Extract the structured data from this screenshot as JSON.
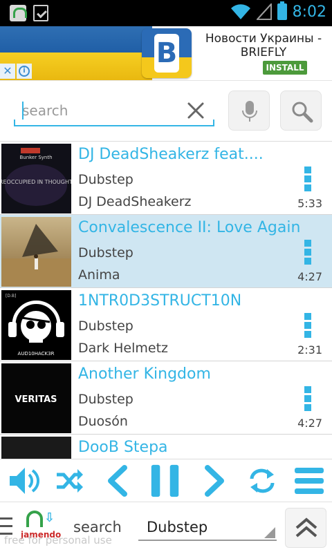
{
  "status_bar": {
    "time": "8:02"
  },
  "ad": {
    "title": "Новости Украины - BRIEFLY",
    "install_label": "INSTALL",
    "logo_letter": "B",
    "close_glyph": "✕",
    "info_glyph": "i"
  },
  "search": {
    "placeholder": "search",
    "value": ""
  },
  "tracks": [
    {
      "title": "DJ DeadSheakerz feat....",
      "genre": "Dubstep",
      "artist": "DJ DeadSheakerz",
      "duration": "5:33",
      "selected": false
    },
    {
      "title": "Convalescence II: Love Again",
      "genre": "Dubstep",
      "artist": "Anima",
      "duration": "4:27",
      "selected": true
    },
    {
      "title": "1NTR0D3STRUCT10N",
      "genre": "Dubstep",
      "artist": "Dark Helmetz",
      "duration": "2:31",
      "selected": false
    },
    {
      "title": "Another Kingdom",
      "genre": "Dubstep",
      "artist": "Duosón",
      "duration": "4:27",
      "selected": false
    },
    {
      "title": "DooB Stepa",
      "genre": "",
      "artist": "",
      "duration": "",
      "selected": false
    }
  ],
  "album_art": {
    "t0_line1": "Bunker Synth",
    "t0_line2": "PREOCCUPIED IN THOUGHTS",
    "t2_caption": "AUD10HACK3R",
    "t2_tag": "[D.B]",
    "t3_caption": "VERITAS"
  },
  "bottom_bar": {
    "logo_name": "jamendo",
    "search_label": "search",
    "genre_selected": "Dubstep",
    "watermark": "free for personal use"
  },
  "colors": {
    "accent": "#33b5e5",
    "selected_row": "#cfe6f2",
    "jamendo_green": "#35a24a",
    "jamendo_red": "#cc2a2a"
  },
  "icons": [
    "volume-icon",
    "shuffle-icon",
    "previous-icon",
    "pause-icon",
    "next-icon",
    "repeat-icon",
    "playlist-icon",
    "microphone-icon",
    "search-icon",
    "clear-icon",
    "overflow-menu-icon",
    "scroll-to-top-icon",
    "hamburger-menu-icon",
    "wifi-icon",
    "signal-icon",
    "battery-icon"
  ]
}
